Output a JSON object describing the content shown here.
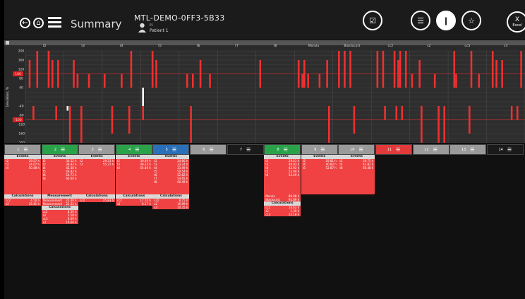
{
  "header": {
    "title": "Summary",
    "slide_id": "MTL-DEMO-0FF3-5B33",
    "patient_sub": "P1",
    "patient_name": "Patient 1",
    "excel_label": "Excel"
  },
  "chart_data": {
    "type": "bar",
    "ylabel": "Deviation, %",
    "yticks": [
      200,
      160,
      120,
      100,
      80,
      40,
      -40,
      -80,
      -100,
      -120,
      -160,
      -200
    ],
    "ylim": [
      -200,
      200
    ],
    "highlight_ticks": [
      100,
      -100
    ],
    "columns": [
      "t2",
      "t3",
      "t4",
      "t5",
      "t6",
      "t7",
      "t8",
      "Morula",
      "Blastocyst",
      "cc2",
      "s2",
      "cc3",
      "s3"
    ]
  },
  "columns": [
    {
      "num": "1",
      "color": "#9a9a9a",
      "events": [
        [
          "t2",
          "29.57 h"
        ],
        [
          "t3",
          "34.07 h"
        ],
        [
          "t4",
          "50.48 h"
        ]
      ],
      "calcs": [
        [
          "cc2",
          "4.50 h"
        ],
        [
          "s2",
          "16.41 h"
        ]
      ]
    },
    {
      "num": "2",
      "color": "#2aa24a",
      "events": [
        [
          "t2",
          "30.52 h"
        ],
        [
          "t3",
          "38.82 h"
        ],
        [
          "t4",
          "42.40 h"
        ],
        [
          "t5",
          "44.82 h"
        ],
        [
          "t6",
          "54.73 h"
        ],
        [
          "t8",
          "66.60 h"
        ]
      ],
      "measure": [
        [
          "Measurement",
          "22.49 h"
        ],
        [
          "Measurement",
          "22.32 h"
        ]
      ],
      "calcs": [
        [
          "cc2",
          "8.30 h"
        ],
        [
          "s2",
          "3.58 h"
        ],
        [
          "cc3",
          "6.09 h"
        ],
        [
          "s3",
          "19.66 h"
        ]
      ]
    },
    {
      "num": "3",
      "color": "#9a9a9a",
      "events": [
        [
          "t2",
          "29.53 h"
        ],
        [
          "t3",
          "55.37 h"
        ]
      ],
      "calcs": [
        [
          "cc2",
          "25.83 h"
        ]
      ]
    },
    {
      "num": "4",
      "color": "#2aa24a",
      "events": [
        [
          "t2",
          "30.49 h"
        ],
        [
          "t3",
          "48.23 h"
        ],
        [
          "t4",
          "54.40 h"
        ]
      ],
      "calcs": [
        [
          "cc2",
          "17.74 h"
        ],
        [
          "s2",
          "6.17 h"
        ]
      ]
    },
    {
      "num": "5",
      "color": "#2a70b8",
      "events": [
        [
          "t2",
          "24.66 h"
        ],
        [
          "t3",
          "33.24 h"
        ],
        [
          "t4",
          "33.49 h"
        ],
        [
          "t5",
          "50.54 h"
        ],
        [
          "t6",
          "52.82 h"
        ],
        [
          "t7",
          "54.65 h"
        ],
        [
          "t8",
          "60.49 h"
        ]
      ],
      "calcs": [
        [
          "cc2",
          "8.75 h"
        ],
        [
          "s2",
          "16.99 h"
        ],
        [
          "s3",
          "10.25 h"
        ]
      ]
    },
    {
      "num": "6",
      "color": "#9a9a9a"
    },
    {
      "num": "7",
      "color": "#1a1a1a"
    },
    {
      "num": "8",
      "color": "#2aa24a",
      "events": [
        [
          "t2",
          "29.41 h"
        ],
        [
          "t3",
          "40.03 h"
        ],
        [
          "t4",
          "42.92 h"
        ],
        [
          "t5",
          "52.99 h"
        ],
        [
          "t8",
          "54.49 h"
        ]
      ],
      "extra": [
        [
          "Morula",
          "89.88 h"
        ],
        [
          "Blastocyst",
          "92.89 h"
        ]
      ],
      "calcs": [
        [
          "cc2",
          "10.62 h"
        ],
        [
          "s2",
          "1.30 h"
        ],
        [
          "cc3",
          "12.18 h"
        ]
      ]
    },
    {
      "num": "9",
      "color": "#9a9a9a",
      "events": [
        [
          "t2",
          "29.81 h"
        ],
        [
          "t4",
          "40.82 h"
        ],
        [
          "t5",
          "52.87 h"
        ]
      ]
    },
    {
      "num": "10",
      "color": "#9a9a9a",
      "events": [
        [
          "t2",
          "29.75 h"
        ],
        [
          "t4",
          "42.82 h"
        ],
        [
          "t8",
          "60.48 h"
        ]
      ]
    },
    {
      "num": "11",
      "color": "#e03a3a"
    },
    {
      "num": "12",
      "color": "#9a9a9a"
    },
    {
      "num": "13",
      "color": "#9a9a9a"
    },
    {
      "num": "14",
      "color": "#1a1a1a"
    }
  ],
  "labels": {
    "events": "Events",
    "calculations": "Calculations",
    "measurement": "Measurement"
  }
}
